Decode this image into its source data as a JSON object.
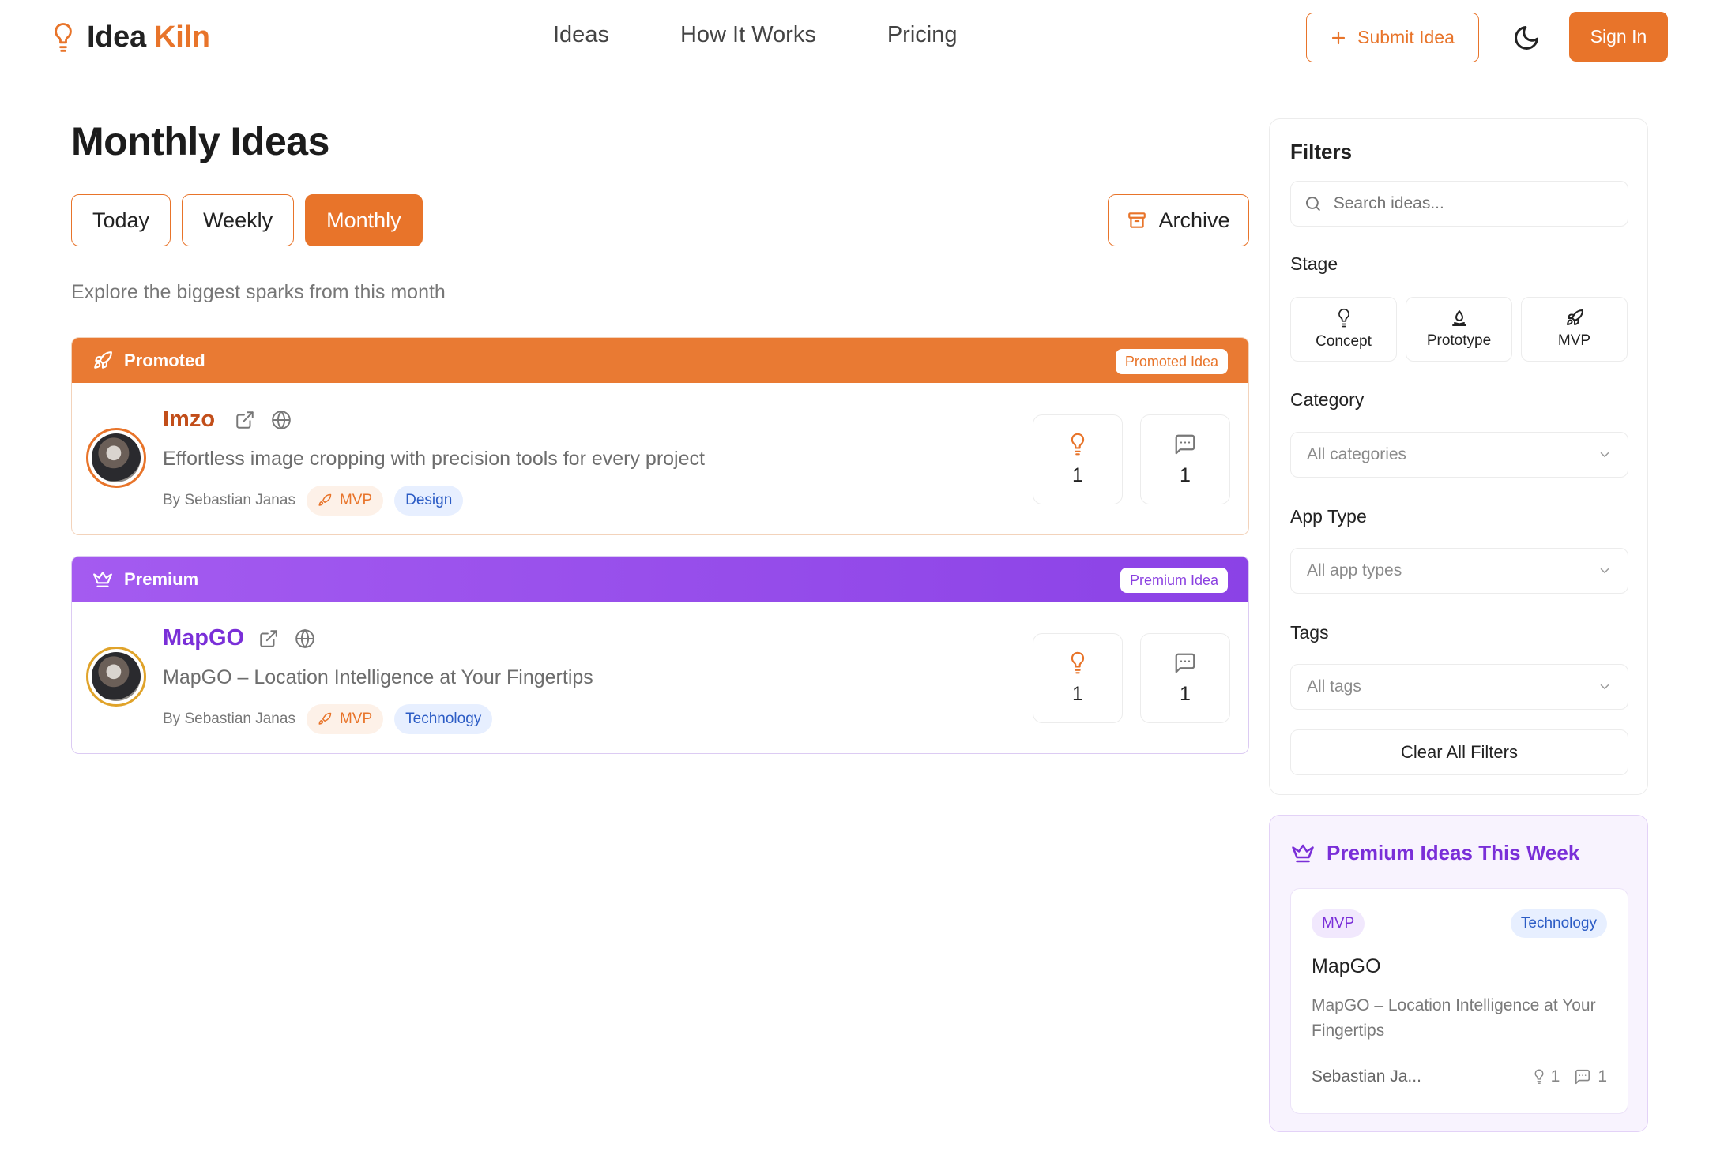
{
  "header": {
    "logo_word1": "Idea",
    "logo_word2": "Kiln",
    "nav": [
      "Ideas",
      "How It Works",
      "Pricing"
    ],
    "submit_label": "Submit Idea",
    "signin_label": "Sign In"
  },
  "main": {
    "title": "Monthly Ideas",
    "tabs": [
      "Today",
      "Weekly",
      "Monthly"
    ],
    "active_tab": "Monthly",
    "archive_label": "Archive",
    "subtitle": "Explore the biggest sparks from this month",
    "cards": [
      {
        "band_label": "Promoted",
        "badge": "Promoted Idea",
        "name": "Imzo",
        "description": "Effortless image cropping with precision tools for every project",
        "author": "By Sebastian Janas",
        "stage": "MVP",
        "category": "Design",
        "upvotes": "1",
        "comments": "1"
      },
      {
        "band_label": "Premium",
        "badge": "Premium Idea",
        "name": "MapGO",
        "description": "MapGO – Location Intelligence at Your Fingertips",
        "author": "By Sebastian Janas",
        "stage": "MVP",
        "category": "Technology",
        "upvotes": "1",
        "comments": "1"
      }
    ]
  },
  "filters": {
    "title": "Filters",
    "search_placeholder": "Search ideas...",
    "stage_label": "Stage",
    "stages": [
      "Concept",
      "Prototype",
      "MVP"
    ],
    "category_label": "Category",
    "category_value": "All categories",
    "app_type_label": "App Type",
    "app_type_value": "All app types",
    "tags_label": "Tags",
    "tags_value": "All tags",
    "clear_label": "Clear All Filters"
  },
  "premium_week": {
    "title": "Premium Ideas This Week",
    "card": {
      "stage": "MVP",
      "category": "Technology",
      "name": "MapGO",
      "description": "MapGO – Location Intelligence at Your Fingertips",
      "author": "Sebastian Ja...",
      "upvotes": "1",
      "comments": "1"
    }
  },
  "colors": {
    "accent": "#e8742a",
    "premium": "#8b42e6",
    "category_blue": "#2c5cc5"
  }
}
